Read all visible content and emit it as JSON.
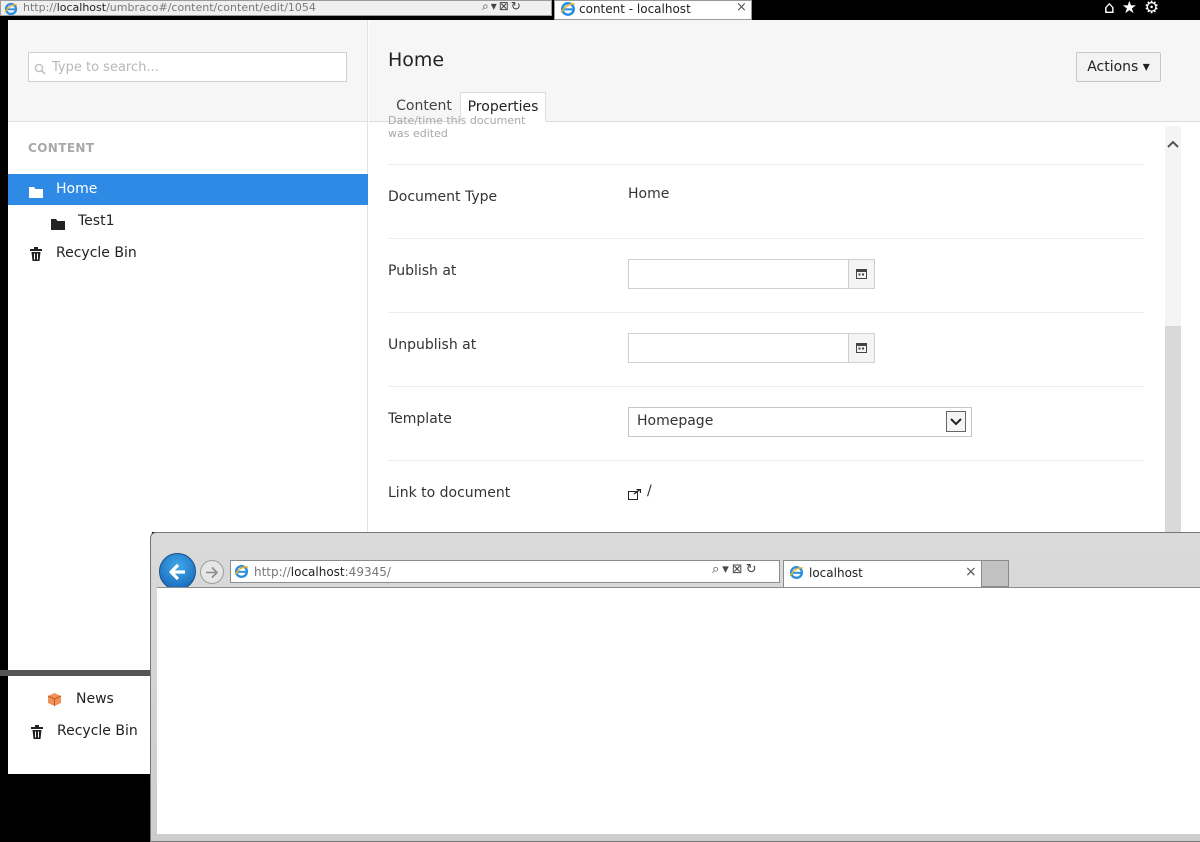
{
  "bg_browser": {
    "address_prefix": "http://",
    "address_host": "localhost",
    "address_path": "/umbraco#/content/content/edit/1054",
    "tab_title": "content - localhost",
    "tab_close": "×",
    "addr_tools": "⌕▾⊠↻",
    "right_icons": "⌂★⚙"
  },
  "tree": {
    "search_placeholder": "Type to search...",
    "section_title": "CONTENT",
    "items": [
      {
        "label": "Home",
        "icon": "folder-icon",
        "selected": true
      },
      {
        "label": "Test1",
        "icon": "folder-icon"
      },
      {
        "label": "Recycle Bin",
        "icon": "trash-icon"
      }
    ]
  },
  "editor": {
    "page_name": "Home",
    "actions_label": "Actions ▾",
    "tabs": [
      "Content",
      "Properties"
    ],
    "clipped_help": "Date/time this document was edited",
    "properties": {
      "document_type_label": "Document Type",
      "document_type_value": "Home",
      "publish_at_label": "Publish at",
      "publish_at_value": "",
      "unpublish_at_label": "Unpublish at",
      "unpublish_at_value": "",
      "template_label": "Template",
      "template_value": "Homepage",
      "link_label": "Link to document",
      "link_value": "/"
    }
  },
  "background_tree_strip": {
    "items": [
      {
        "label": "News",
        "icon": "package-icon"
      },
      {
        "label": "Recycle Bin",
        "icon": "trash-icon"
      }
    ]
  },
  "front_browser": {
    "address_prefix": "http://",
    "address_host": "localhost",
    "address_path": ":49345/",
    "tab_title": "localhost",
    "tab_close": "×",
    "addr_tools": "⌕▾⊠↻"
  },
  "colors": {
    "accent": "#2e8ae5",
    "ie_back": "#1f74c4"
  }
}
